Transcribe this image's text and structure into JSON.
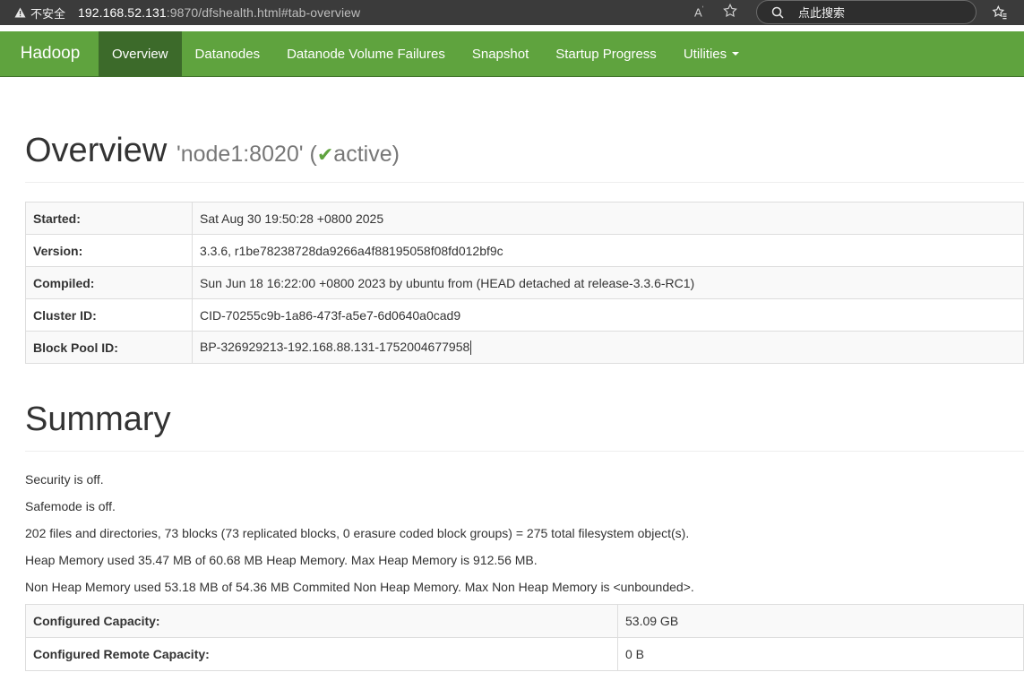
{
  "browser": {
    "security_label": "不安全",
    "url_host": "192.168.52.131",
    "url_path": ":9870/dfshealth.html#tab-overview",
    "search_placeholder": "点此搜索"
  },
  "navbar": {
    "brand": "Hadoop",
    "items": [
      {
        "label": "Overview"
      },
      {
        "label": "Datanodes"
      },
      {
        "label": "Datanode Volume Failures"
      },
      {
        "label": "Snapshot"
      },
      {
        "label": "Startup Progress"
      },
      {
        "label": "Utilities"
      }
    ],
    "accent_color": "#5fa33e",
    "active_color": "#3c6a2a"
  },
  "overview": {
    "title": "Overview",
    "node": "'node1:8020'",
    "status": "active",
    "rows": [
      {
        "label": "Started:",
        "value": "Sat Aug 30 19:50:28 +0800 2025"
      },
      {
        "label": "Version:",
        "value": "3.3.6, r1be78238728da9266a4f88195058f08fd012bf9c"
      },
      {
        "label": "Compiled:",
        "value": "Sun Jun 18 16:22:00 +0800 2023 by ubuntu from (HEAD detached at release-3.3.6-RC1)"
      },
      {
        "label": "Cluster ID:",
        "value": "CID-70255c9b-1a86-473f-a5e7-6d0640a0cad9"
      },
      {
        "label": "Block Pool ID:",
        "value": "BP-326929213-192.168.88.131-1752004677958"
      }
    ]
  },
  "summary": {
    "title": "Summary",
    "lines": [
      "Security is off.",
      "Safemode is off.",
      "202 files and directories, 73 blocks (73 replicated blocks, 0 erasure coded block groups) = 275 total filesystem object(s).",
      "Heap Memory used 35.47 MB of 60.68 MB Heap Memory. Max Heap Memory is 912.56 MB.",
      "Non Heap Memory used 53.18 MB of 54.36 MB Commited Non Heap Memory. Max Non Heap Memory is <unbounded>."
    ],
    "rows": [
      {
        "label": "Configured Capacity:",
        "value": "53.09 GB"
      },
      {
        "label": "Configured Remote Capacity:",
        "value": "0 B"
      }
    ]
  }
}
